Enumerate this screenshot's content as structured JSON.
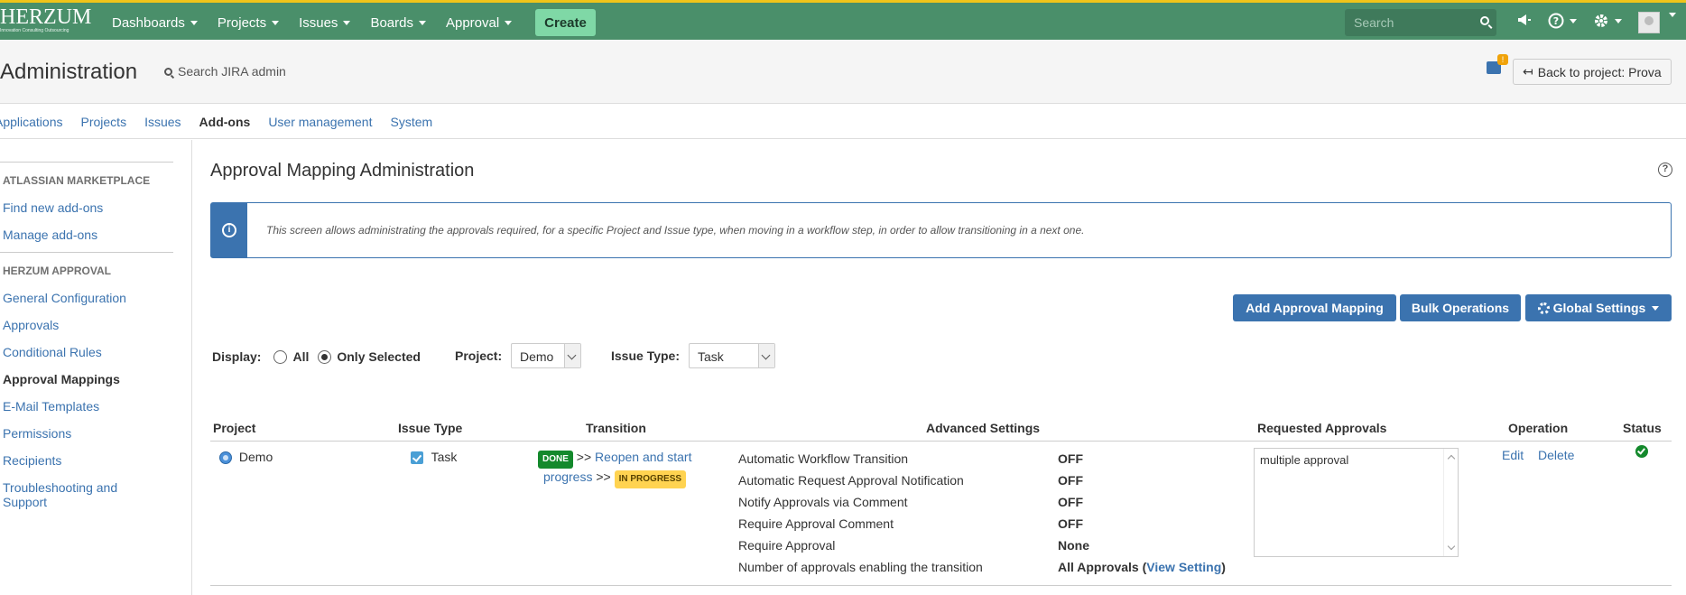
{
  "topnav": {
    "logo": "HERZUM",
    "logo_tagline": "Innovation Consulting Outsourcing",
    "items": [
      {
        "label": "Dashboards"
      },
      {
        "label": "Projects"
      },
      {
        "label": "Issues"
      },
      {
        "label": "Boards"
      },
      {
        "label": "Approval"
      }
    ],
    "create_label": "Create",
    "search_placeholder": "Search"
  },
  "admin": {
    "title": "Administration",
    "search_label": "Search JIRA admin",
    "feedback_badge": "!",
    "back_label": "Back to project: Prova"
  },
  "tabs": [
    {
      "label": "Applications"
    },
    {
      "label": "Projects"
    },
    {
      "label": "Issues"
    },
    {
      "label": "Add-ons"
    },
    {
      "label": "User management"
    },
    {
      "label": "System"
    }
  ],
  "sidebar": {
    "marketplace_heading": "ATLASSIAN MARKETPLACE",
    "marketplace_items": [
      "Find new add-ons",
      "Manage add-ons"
    ],
    "approval_heading": "HERZUM APPROVAL",
    "approval_items": [
      "General Configuration",
      "Approvals",
      "Conditional Rules",
      "Approval Mappings",
      "E-Mail Templates",
      "Permissions",
      "Recipients",
      "Troubleshooting and Support"
    ]
  },
  "main": {
    "title": "Approval Mapping Administration",
    "info_text": "This screen allows administrating the approvals required, for a specific Project and Issue type, when moving in a workflow step, in order to allow transitioning in a next one.",
    "buttons": {
      "add": "Add Approval Mapping",
      "bulk": "Bulk Operations",
      "global": "Global Settings"
    },
    "filter": {
      "display_label": "Display:",
      "all_label": "All",
      "only_selected_label": "Only Selected",
      "project_label": "Project:",
      "project_value": "Demo",
      "issue_type_label": "Issue Type:",
      "issue_type_value": "Task"
    },
    "table": {
      "headers": [
        "Project",
        "Issue Type",
        "Transition",
        "Advanced Settings",
        "Requested Approvals",
        "Operation",
        "Status"
      ],
      "row": {
        "project": "Demo",
        "issue_type": "Task",
        "transition_from": "DONE",
        "transition_sep1": ">>",
        "transition_name_1": "Reopen and start",
        "transition_name_2": "progress",
        "transition_sep2": ">>",
        "transition_to": "IN PROGRESS",
        "advanced": [
          {
            "label": "Automatic Workflow Transition",
            "value": "OFF"
          },
          {
            "label": "Automatic Request Approval Notification",
            "value": "OFF"
          },
          {
            "label": "Notify Approvals via Comment",
            "value": "OFF"
          },
          {
            "label": "Require Approval Comment",
            "value": "OFF"
          },
          {
            "label": "Require Approval",
            "value": "None"
          },
          {
            "label": "Number of approvals enabling the transition",
            "value": "All Approvals"
          }
        ],
        "view_setting_open": "(",
        "view_setting_link": "View Setting",
        "view_setting_close": ")",
        "requested_approvals": "multiple approval",
        "edit_label": "Edit",
        "delete_label": "Delete"
      }
    }
  },
  "colors": {
    "topbar": "#4a8f6a",
    "link": "#3b73af",
    "primary_button": "#3b73af",
    "done_lozenge": "#14892c",
    "in_progress_lozenge": "#ffd351"
  }
}
